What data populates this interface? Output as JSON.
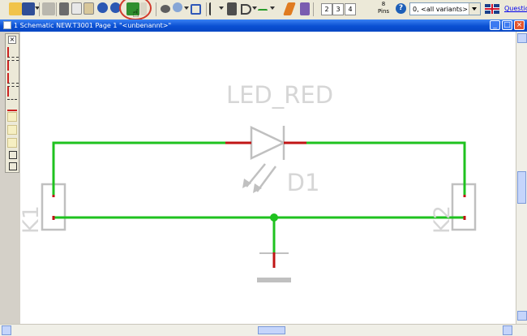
{
  "toolbar": {
    "pins_label": "Pins",
    "pins_count": "8",
    "page_buttons": [
      "2",
      "3",
      "4"
    ],
    "variant_select": "0, <all variants>",
    "help_glyph": "?",
    "question_link": "Question"
  },
  "window": {
    "title": "1 Schematic NEW.T3001 Page 1 \"<unbenannt>\"",
    "min_glyph": "_",
    "max_glyph": "□",
    "close_glyph": "×"
  },
  "sidebar": {
    "close_glyph": "×"
  },
  "schematic": {
    "part_name": "LED_RED",
    "ref_designator": "D1",
    "connector_left": "K1",
    "connector_right": "K2"
  },
  "colors": {
    "wire": "#1fc21f",
    "pin": "#c01515",
    "part_outline": "#c0c0c0",
    "part_text": "#d6d6d6",
    "title_bar": "#0a4fd2",
    "selection_circle": "#d13a2c"
  }
}
